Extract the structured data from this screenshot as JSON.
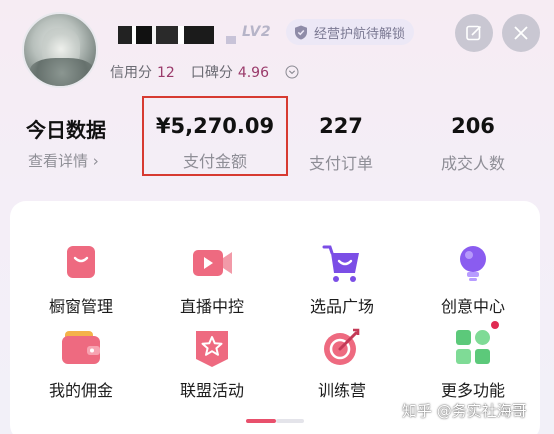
{
  "header": {
    "level": "LV2",
    "guard_badge": "经营护航待解锁",
    "credit_label": "信用分",
    "credit_value": "12",
    "reputation_label": "口碑分",
    "reputation_value": "4.96"
  },
  "stats": {
    "title": "今日数据",
    "details_link": "查看详情 ›",
    "items": [
      {
        "value": "¥5,270.09",
        "label": "支付金额"
      },
      {
        "value": "227",
        "label": "支付订单"
      },
      {
        "value": "206",
        "label": "成交人数"
      }
    ]
  },
  "tools": [
    {
      "label": "橱窗管理",
      "icon": "shop-window-icon"
    },
    {
      "label": "直播中控",
      "icon": "live-video-icon"
    },
    {
      "label": "选品广场",
      "icon": "shopping-cart-icon"
    },
    {
      "label": "创意中心",
      "icon": "lightbulb-icon"
    },
    {
      "label": "我的佣金",
      "icon": "wallet-icon"
    },
    {
      "label": "联盟活动",
      "icon": "star-badge-icon"
    },
    {
      "label": "训练营",
      "icon": "target-icon"
    },
    {
      "label": "更多功能",
      "icon": "grid-apps-icon"
    }
  ],
  "pager": {
    "page_count": 2,
    "current_page": 1
  },
  "watermark": "知乎 @务实社海哥",
  "colors": {
    "accent": "#e8506c",
    "highlight_border": "#d73a31",
    "score_value": "#9a3a6a",
    "icon_pink": "#e8506c",
    "icon_purple": "#7b4ee6"
  }
}
